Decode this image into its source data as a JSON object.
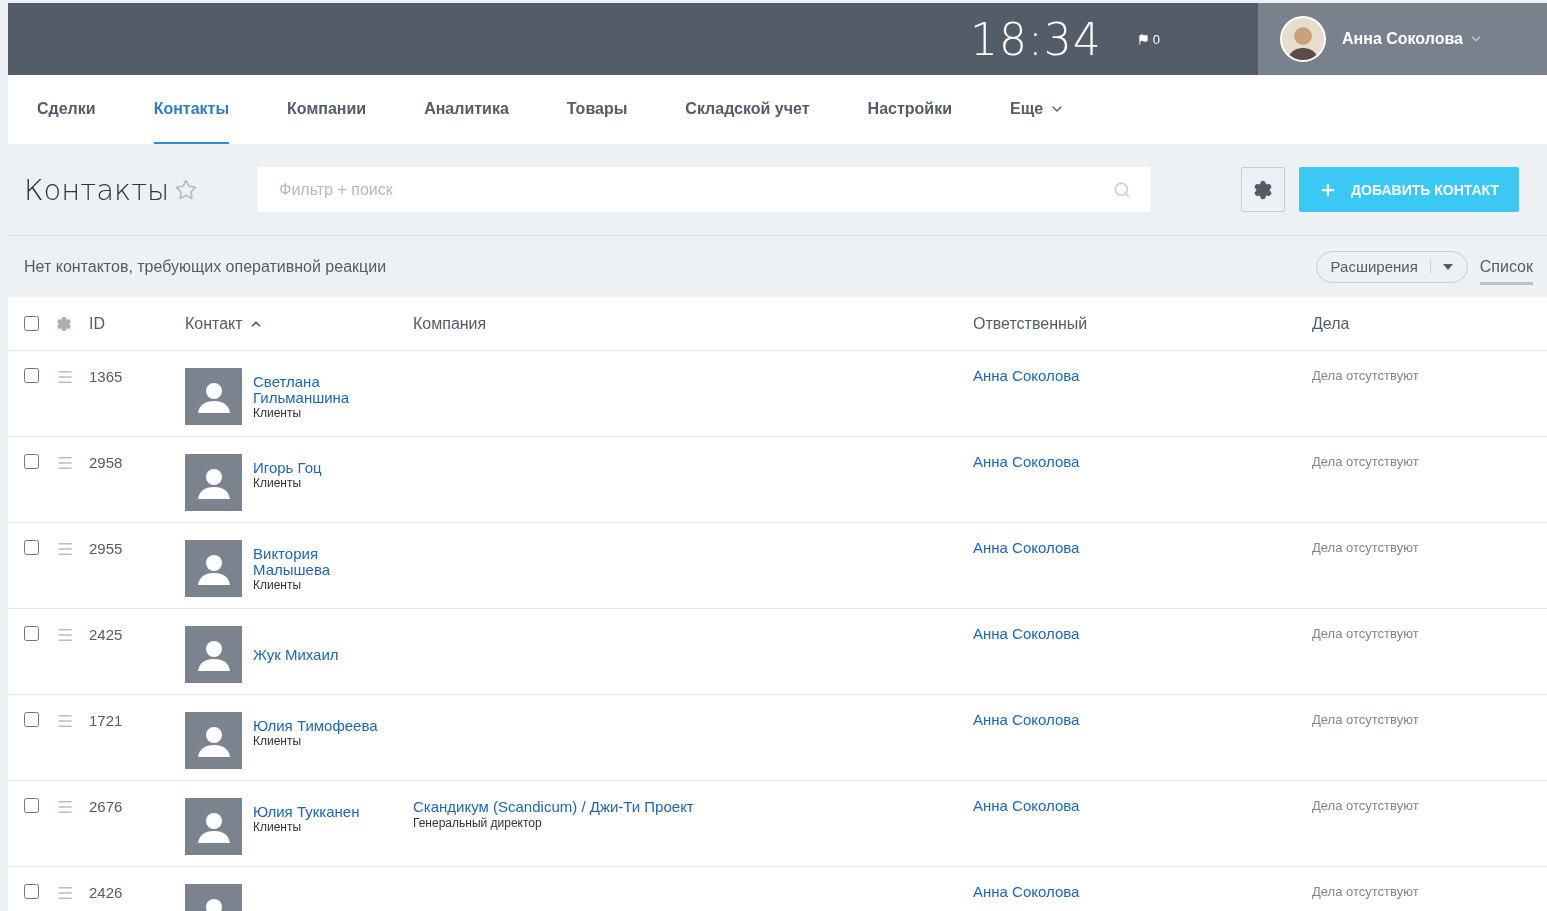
{
  "topbar": {
    "time": "18:34",
    "flag_count": "0",
    "user": {
      "name": "Анна Соколова"
    }
  },
  "nav": [
    {
      "label": "Сделки",
      "selected": false,
      "kind": "link"
    },
    {
      "label": "Контакты",
      "selected": true,
      "kind": "link"
    },
    {
      "label": "Компании",
      "selected": false,
      "kind": "link"
    },
    {
      "label": "Аналитика",
      "selected": false,
      "kind": "link"
    },
    {
      "label": "Товары",
      "selected": false,
      "kind": "link"
    },
    {
      "label": "Складской учет",
      "selected": false,
      "kind": "link"
    },
    {
      "label": "Настройки",
      "selected": false,
      "kind": "link"
    },
    {
      "label": "Еще",
      "selected": false,
      "kind": "menu"
    }
  ],
  "header": {
    "title": "Контакты",
    "favorite": false,
    "search": {
      "placeholder": "Фильтр + поиск"
    },
    "add_button": "ДОБАВИТЬ КОНТАКТ"
  },
  "notice": "Нет контактов, требующих оперативной реакции",
  "extensions_button": "Расширения",
  "view_tab": {
    "label": "Список",
    "selected": true
  },
  "table": {
    "select_all": {
      "checked": false
    },
    "columns": [
      {
        "label": "ID",
        "sorted": false
      },
      {
        "label": "Контакт",
        "sorted": true
      },
      {
        "label": "Компания",
        "sorted": false
      },
      {
        "label": "Ответственный",
        "sorted": false
      },
      {
        "label": "Дела",
        "sorted": false
      }
    ],
    "rows": [
      {
        "checked": false,
        "id": "1365",
        "name": "Светлана Гильманшина",
        "group": "Клиенты",
        "responsible": "Анна Соколова",
        "tasks": "Дела отсутствуют"
      },
      {
        "checked": false,
        "id": "2958",
        "name": "Игорь Гоц",
        "group": "Клиенты",
        "responsible": "Анна Соколова",
        "tasks": "Дела отсутствуют"
      },
      {
        "checked": false,
        "id": "2955",
        "name": "Виктория Малышева",
        "group": "Клиенты",
        "responsible": "Анна Соколова",
        "tasks": "Дела отсутствуют"
      },
      {
        "checked": false,
        "id": "2425",
        "name": "Жук Михаил",
        "responsible": "Анна Соколова",
        "tasks": "Дела отсутствуют"
      },
      {
        "checked": false,
        "id": "1721",
        "name": "Юлия Тимофеева",
        "group": "Клиенты",
        "responsible": "Анна Соколова",
        "tasks": "Дела отсутствуют"
      },
      {
        "checked": false,
        "id": "2676",
        "name": "Юлия Тукканен",
        "group": "Клиенты",
        "company": "Скандикум (Scandicum) / Джи-Ти Проект",
        "company_role": "Генеральный директор",
        "responsible": "Анна Соколова",
        "tasks": "Дела отсутствуют"
      },
      {
        "checked": false,
        "id": "2426",
        "responsible": "Анна Соколова",
        "tasks": "Дела отсутствуют"
      }
    ]
  }
}
